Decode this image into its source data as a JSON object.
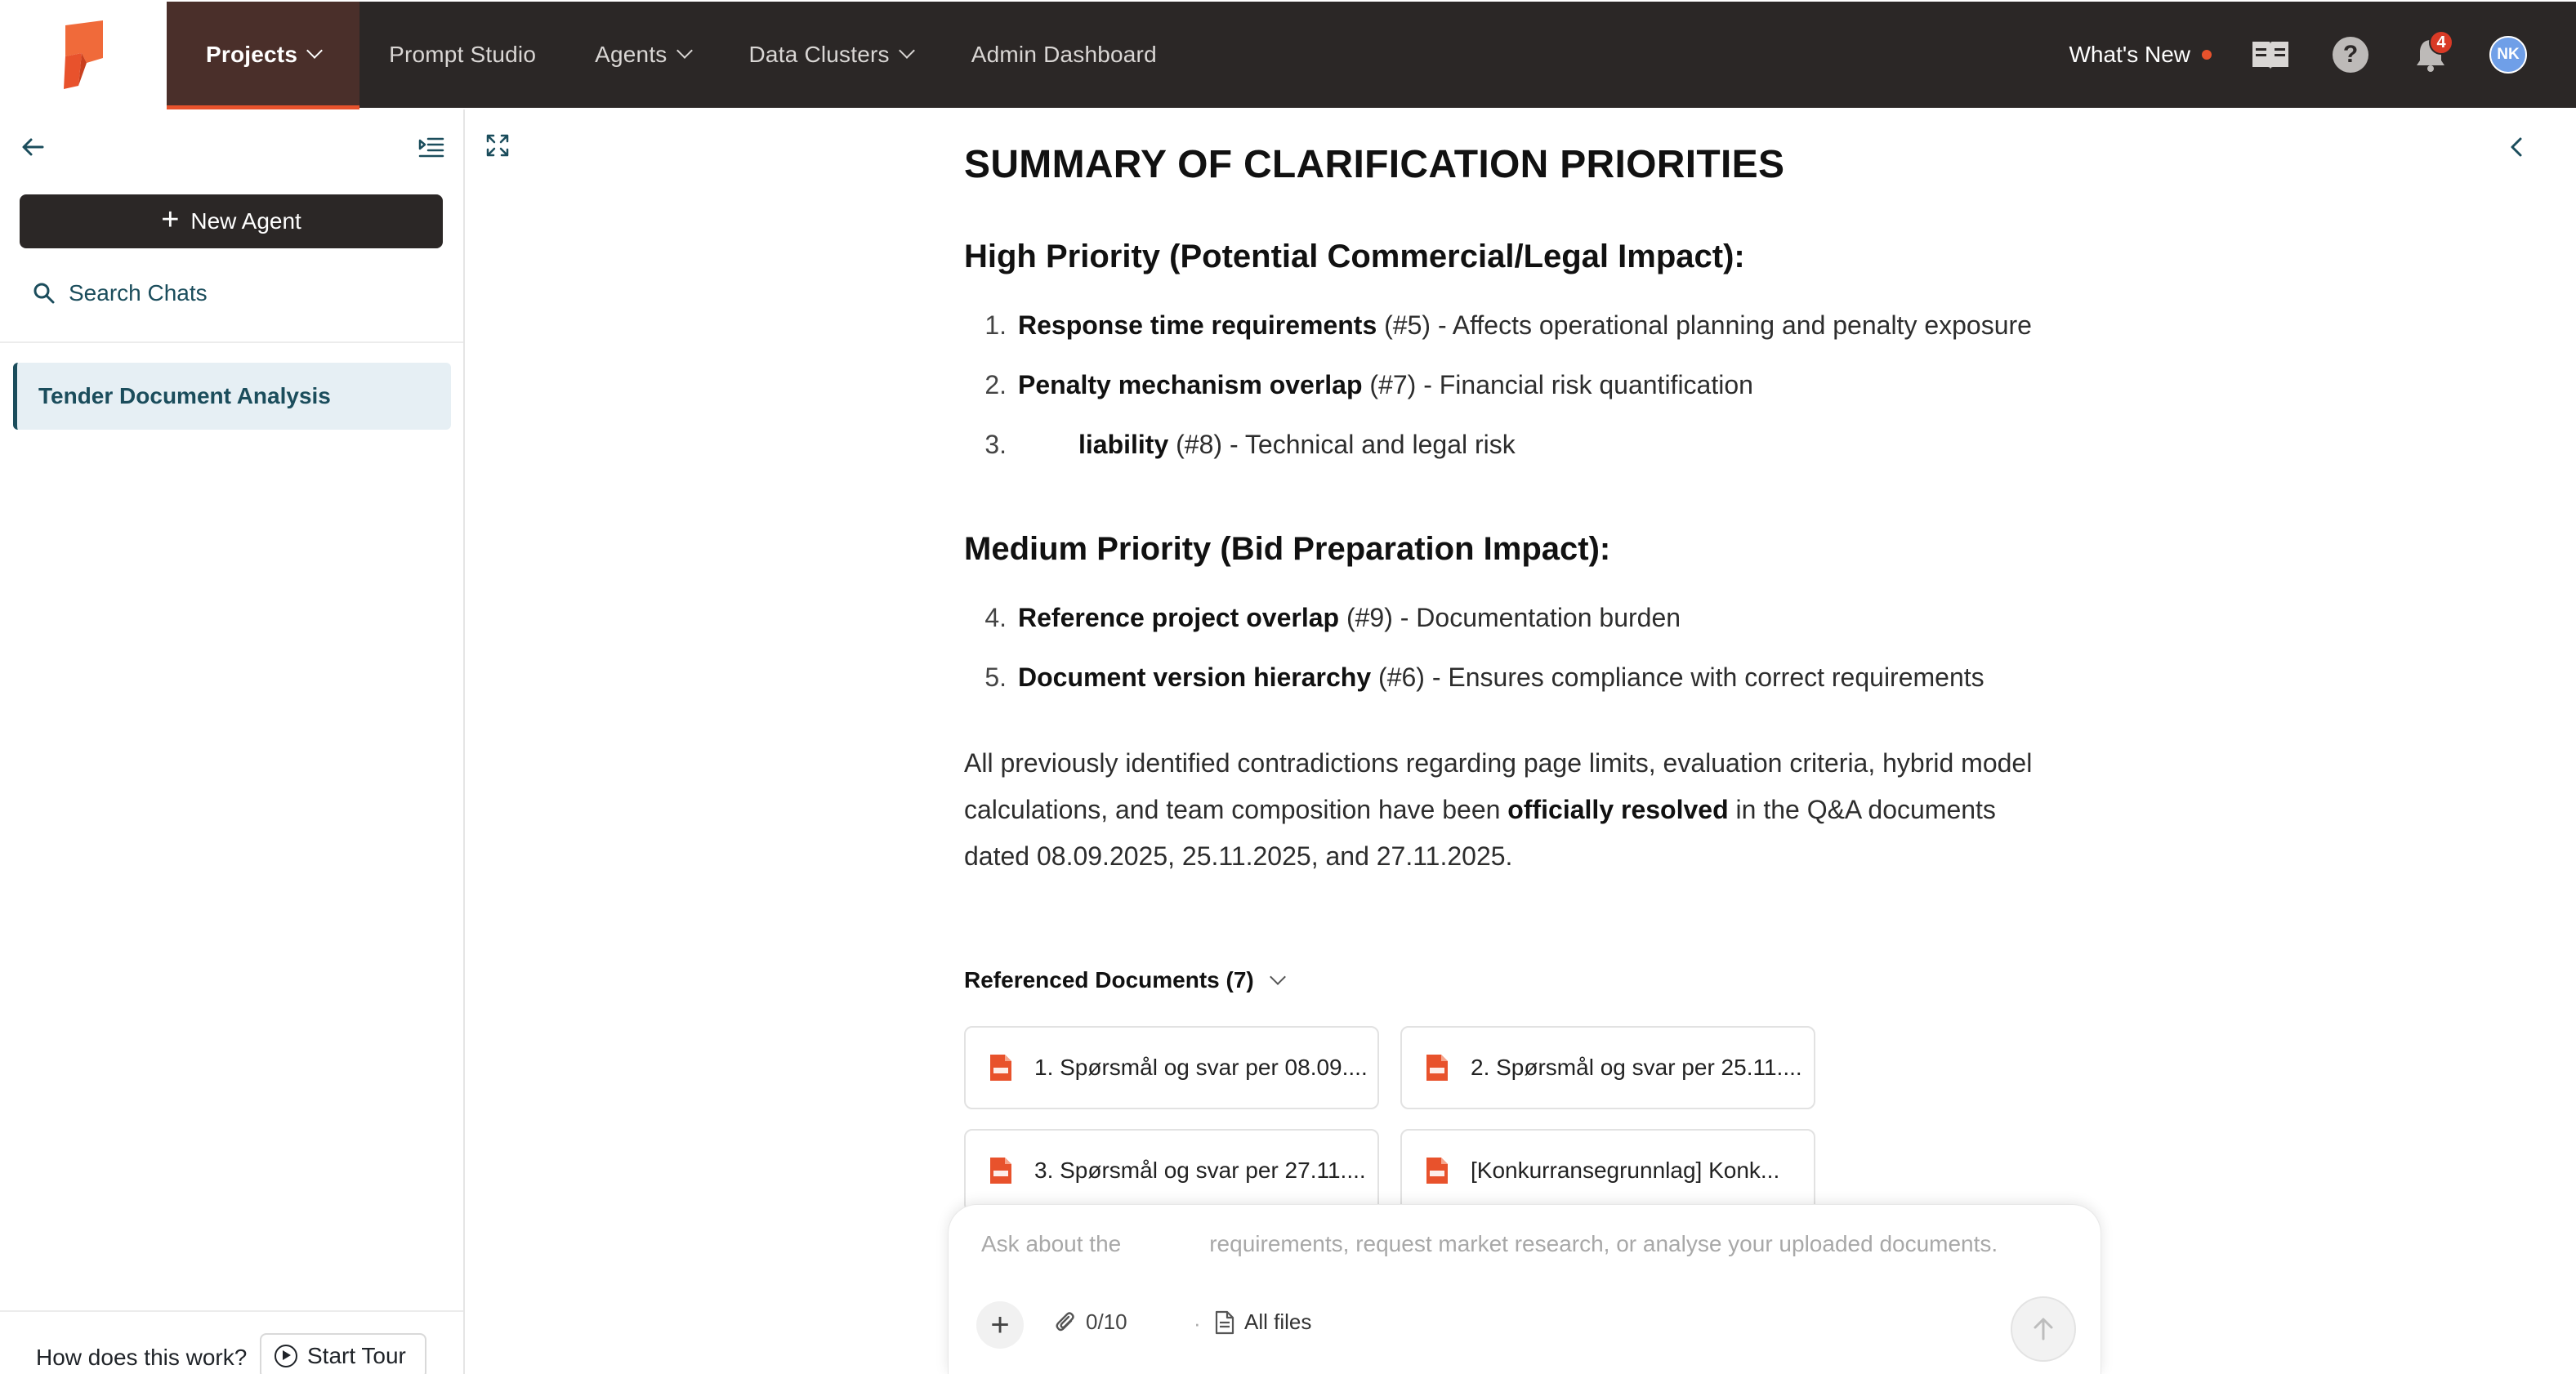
{
  "nav": {
    "items": [
      {
        "label": "Projects",
        "active": true,
        "has_dropdown": true
      },
      {
        "label": "Prompt Studio",
        "active": false,
        "has_dropdown": false
      },
      {
        "label": "Agents",
        "active": false,
        "has_dropdown": true
      },
      {
        "label": "Data Clusters",
        "active": false,
        "has_dropdown": true
      },
      {
        "label": "Admin Dashboard",
        "active": false,
        "has_dropdown": false
      }
    ],
    "whats_new": "What's New",
    "notification_count": "4",
    "avatar_initials": "NK",
    "help_glyph": "?"
  },
  "sidebar": {
    "new_agent_label": "New Agent",
    "search_label": "Search Chats",
    "chats": [
      {
        "title": "Tender Document Analysis",
        "selected": true
      }
    ],
    "how_text": "How does this work?",
    "start_tour_label": "Start Tour"
  },
  "main": {
    "title": "SUMMARY OF CLARIFICATION PRIORITIES",
    "high_heading": "High Priority (Potential Commercial/Legal Impact):",
    "high_items": [
      {
        "num": "1.",
        "bold": "Response time requirements",
        "rest": " (#5) - Affects operational planning and penalty exposure"
      },
      {
        "num": "2.",
        "bold": "Penalty mechanism overlap",
        "rest": " (#7) - Financial risk quantification"
      },
      {
        "num": "3.",
        "bold": "liability",
        "rest": " (#8) - Technical and legal risk"
      }
    ],
    "medium_heading": "Medium Priority (Bid Preparation Impact):",
    "medium_items": [
      {
        "num": "4.",
        "bold": "Reference project overlap",
        "rest": " (#9) - Documentation burden"
      },
      {
        "num": "5.",
        "bold": "Document version hierarchy",
        "rest": " (#6) - Ensures compliance with correct requirements"
      }
    ],
    "paragraph": {
      "before": "All previously identified contradictions regarding page limits, evaluation criteria, hybrid model calculations, and team composition have been ",
      "bold": "officially resolved",
      "after": " in the Q&A documents dated 08.09.2025, 25.11.2025, and 27.11.2025."
    },
    "referenced_label": "Referenced Documents (7)",
    "documents": [
      "1. Spørsmål og svar per 08.09....",
      "2. Spørsmål og svar per 25.11....",
      "3. Spørsmål og svar per 27.11....",
      "[Konkurransegrunnlag] Konk..."
    ]
  },
  "composer": {
    "placeholder_start": "Ask about the",
    "placeholder_end": "requirements, request market research, or analyse your uploaded documents.",
    "attachments": "0/10",
    "separator": "·",
    "files_label": "All files"
  },
  "colors": {
    "nav_bg": "#2b2726",
    "nav_active_bg": "#4a2f2a",
    "accent": "#e8522c",
    "sidebar_accent": "#1b4d5c",
    "selected_bg": "#e6eff4",
    "pdf_red": "#e8522c"
  },
  "icons": [
    "brand-logo-icon",
    "chevron-down-icon",
    "book-icon",
    "help-icon",
    "bell-icon",
    "arrow-left-icon",
    "sidebar-collapse-icon",
    "plus-icon",
    "search-icon",
    "expand-icon",
    "chevron-left-icon",
    "pdf-icon",
    "paperclip-icon",
    "file-icon",
    "arrow-up-icon",
    "play-circle-icon"
  ]
}
